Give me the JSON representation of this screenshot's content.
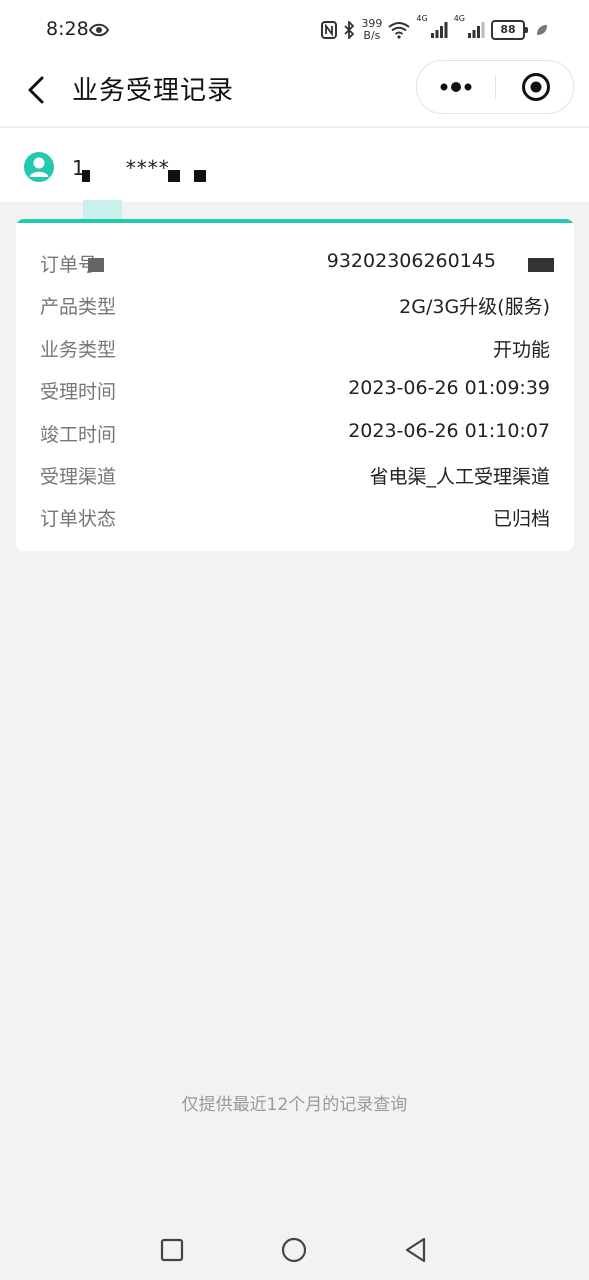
{
  "status_bar": {
    "time": "8:28",
    "net_speed_value": "399",
    "net_speed_unit": "B/s",
    "signal_label_1": "4G",
    "signal_label_2": "4G",
    "battery": "88"
  },
  "header": {
    "title": "业务受理记录"
  },
  "user": {
    "phone_prefix": "1",
    "phone_masked": "****"
  },
  "order": {
    "fields": [
      {
        "label": "订单号",
        "value": "93202306260145"
      },
      {
        "label": "产品类型",
        "value": "2G/3G升级(服务)"
      },
      {
        "label": "业务类型",
        "value": "开功能"
      },
      {
        "label": "受理时间",
        "value": "2023-06-26 01:09:39"
      },
      {
        "label": "竣工时间",
        "value": "2023-06-26 01:10:07"
      },
      {
        "label": "受理渠道",
        "value": "省电渠_人工受理渠道"
      },
      {
        "label": "订单状态",
        "value": "已归档"
      }
    ]
  },
  "footer": {
    "note": "仅提供最近12个月的记录查询"
  },
  "colors": {
    "accent": "#22c8b0",
    "background": "#f2f2f2"
  }
}
